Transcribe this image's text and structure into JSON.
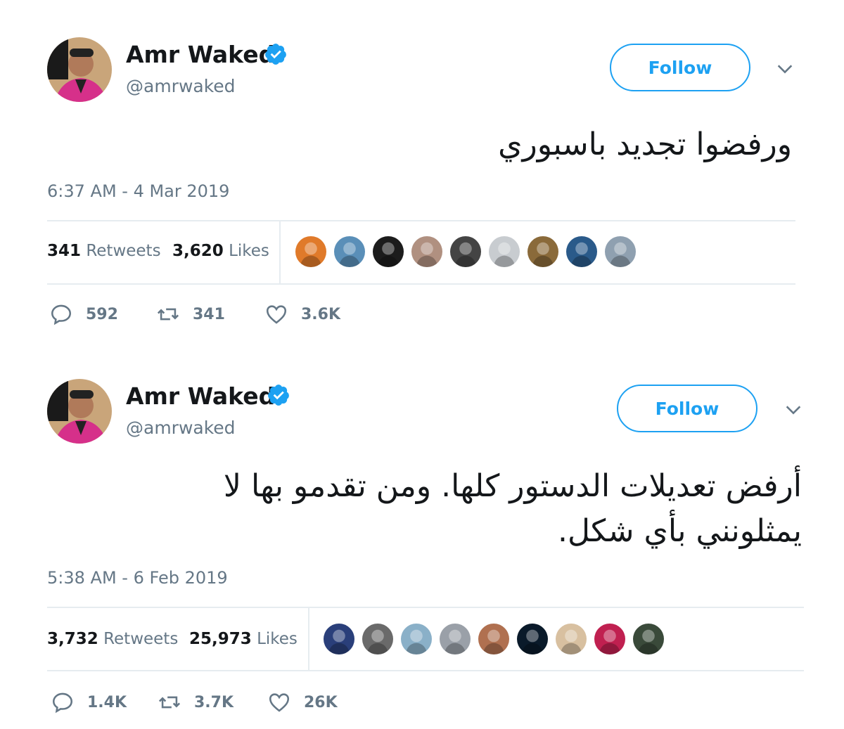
{
  "tweets": [
    {
      "author_name": "Amr Waked",
      "handle": "@amrwaked",
      "follow_label": "Follow",
      "text": "ورفضوا تجديد باسبوري",
      "timestamp": "6:37 AM - 4 Mar 2019",
      "retweets_count": "341",
      "retweets_label": "Retweets",
      "likes_count": "3,620",
      "likes_label": "Likes",
      "likers": [
        "#e07a2a",
        "#5a8fb8",
        "#1c1c1c",
        "#b09080",
        "#444444",
        "#c8ccd0",
        "#8a6a3a",
        "#2a5a8a",
        "#8fa0b0"
      ],
      "reply_count": "592",
      "retweet_count": "341",
      "like_count": "3.6K"
    },
    {
      "author_name": "Amr Waked",
      "handle": "@amrwaked",
      "follow_label": "Follow",
      "text_line1": "أرفض تعديلات الدستور كلها. ومن تقدمو بها لا",
      "text_line2": "يمثلونني بأي شكل.",
      "timestamp": "5:38 AM - 6 Feb 2019",
      "retweets_count": "3,732",
      "retweets_label": "Retweets",
      "likes_count": "25,973",
      "likes_label": "Likes",
      "likers": [
        "#2a3f7a",
        "#6a6a6a",
        "#8ab0c8",
        "#9aa0a8",
        "#b07050",
        "#0a1a2a",
        "#d8c0a0",
        "#c02050",
        "#3a4a3a"
      ],
      "reply_count": "1.4K",
      "retweet_count": "3.7K",
      "like_count": "26K"
    }
  ],
  "colors": {
    "accent": "#1da1f2",
    "muted": "#657786",
    "divider": "#e6ecf0"
  }
}
